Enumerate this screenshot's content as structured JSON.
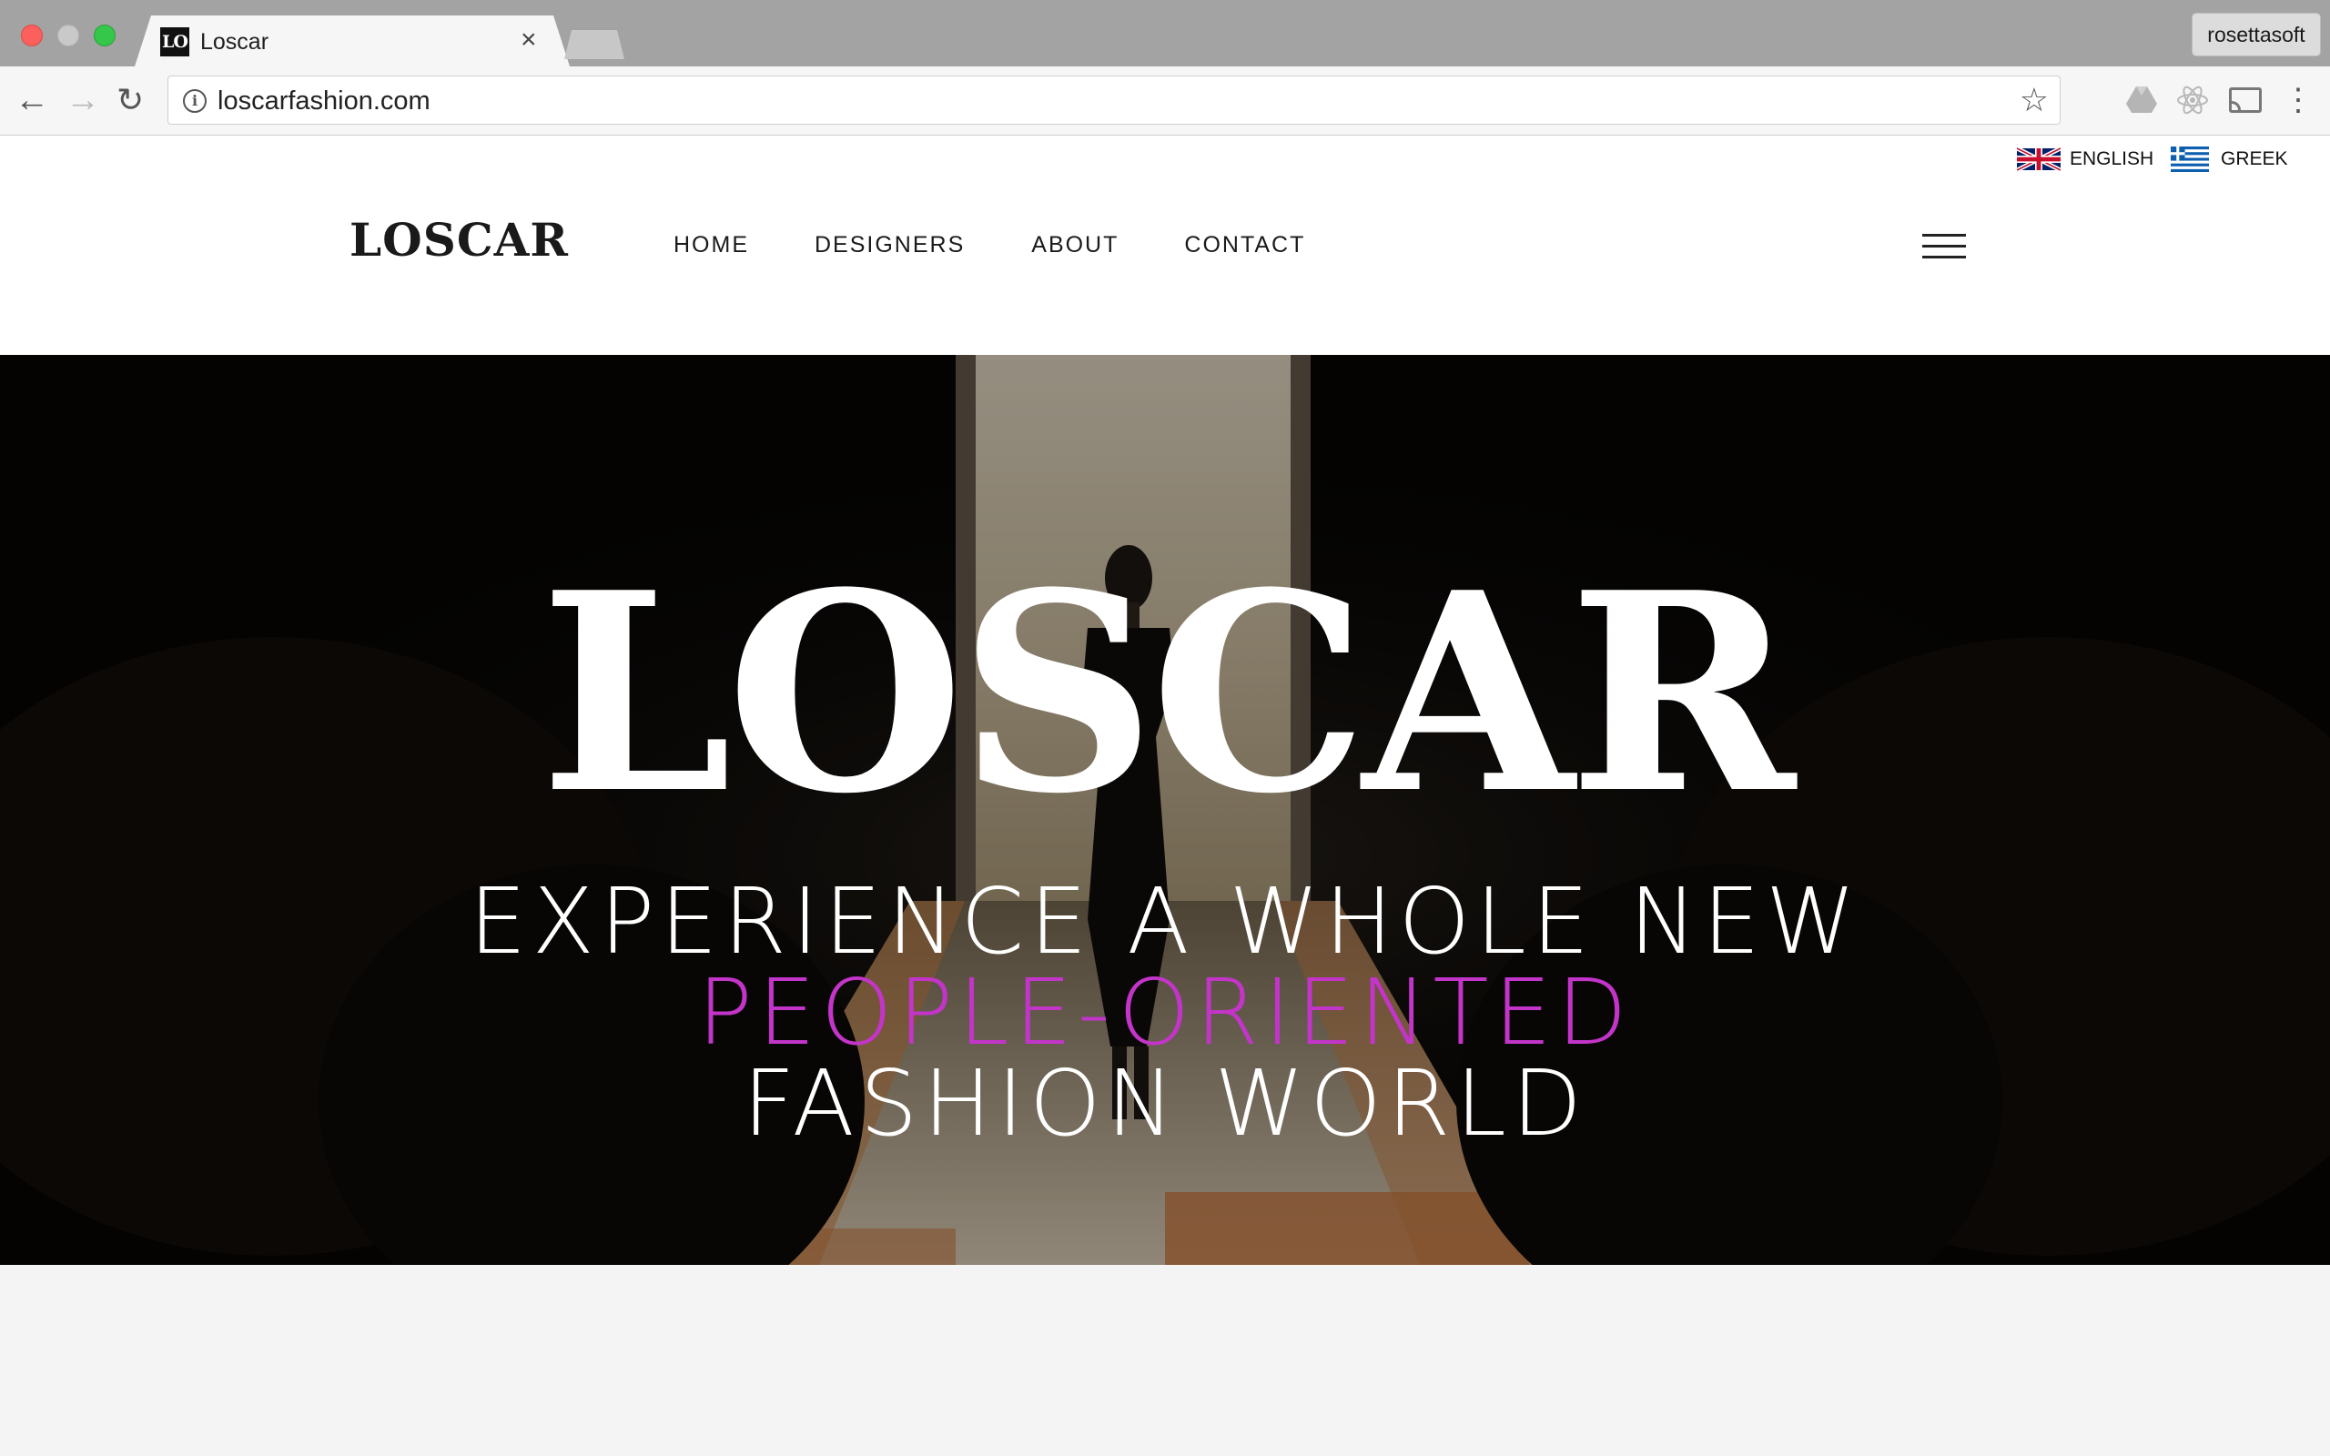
{
  "browser": {
    "tab": {
      "favicon_text": "LO",
      "title": "Loscar",
      "close_glyph": "×"
    },
    "profile": {
      "label": "rosettasoft"
    },
    "nav": {
      "back_glyph": "←",
      "forward_glyph": "→",
      "reload_glyph": "↻"
    },
    "address": {
      "url": "loscarfashion.com",
      "info_glyph": "i",
      "star_glyph": "☆"
    },
    "menu_glyph": "⋮",
    "icons": [
      "back-icon",
      "forward-icon",
      "reload-icon",
      "info-icon",
      "star-icon",
      "drive-icon",
      "react-devtools-icon",
      "cast-icon",
      "kebab-menu-icon"
    ]
  },
  "languages": [
    {
      "label": "ENGLISH",
      "flag": "uk-flag-icon"
    },
    {
      "label": "GREEK",
      "flag": "greece-flag-icon"
    }
  ],
  "header": {
    "logo": "LOSCAR",
    "nav": [
      "HOME",
      "DESIGNERS",
      "ABOUT",
      "CONTACT"
    ]
  },
  "hero": {
    "title": "LOSCAR",
    "line1": "EXPERIENCE A WHOLE NEW",
    "line2": "PEOPLE-ORIENTED",
    "line3": "FASHION WORLD",
    "accent_color": "#c334c9"
  },
  "colors": {
    "tab_bar": "#a3a3a3",
    "page_bg": "#f4f4f4",
    "text_dark": "#1a1a1a"
  }
}
